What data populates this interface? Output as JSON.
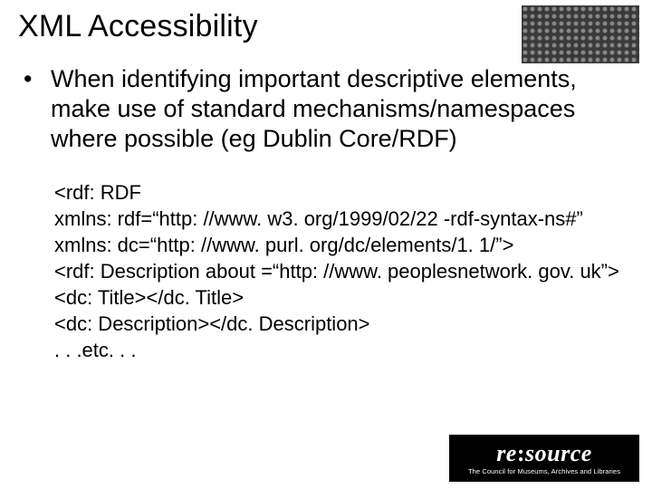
{
  "title": "XML Accessibility",
  "bullet_marker": "•",
  "bullet_text": "When identifying important descriptive elements, make use of standard mechanisms/namespaces where possible (eg Dublin Core/RDF)",
  "code": {
    "l1": "<rdf: RDF",
    "l2": "xmlns: rdf=“http: //www. w3. org/1999/02/22 -rdf-syntax-ns#”",
    "l3": "xmlns: dc=“http: //www. purl. org/dc/elements/1. 1/”>",
    "l4": "<rdf: Description about =“http: //www. peoplesnetwork. gov. uk”>",
    "l5": "<dc: Title></dc. Title>",
    "l6": "<dc: Description></dc. Description>",
    "l7": ". . .etc. . ."
  },
  "logo": {
    "brand_left": "re",
    "brand_right": "source",
    "sub": "The Council for Museums, Archives and Libraries"
  }
}
